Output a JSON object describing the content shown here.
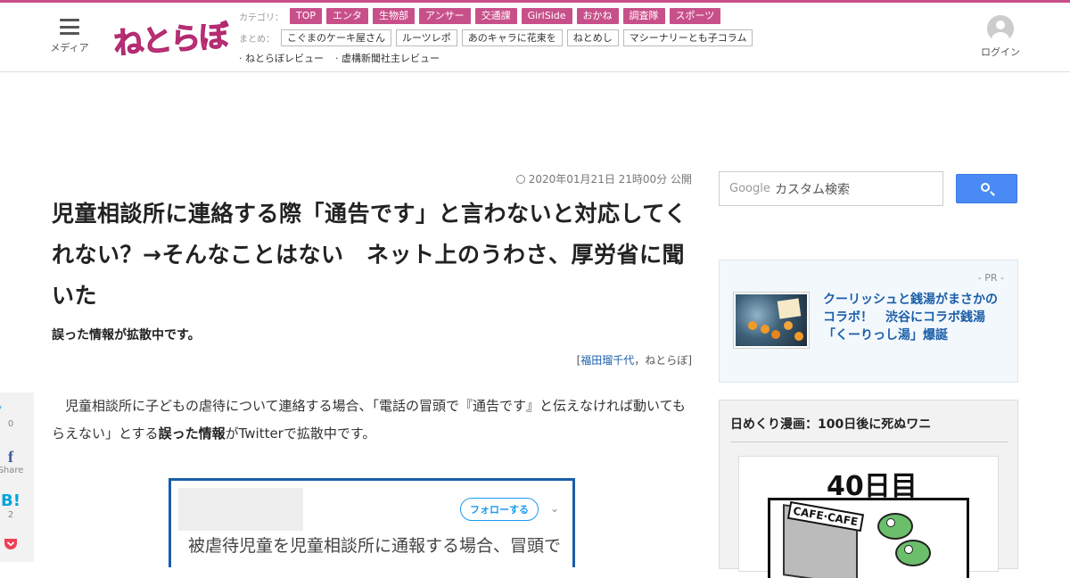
{
  "header": {
    "menu_label": "メディア",
    "logo_text": "ねとらぼ",
    "category_label": "カテゴリ：",
    "categories": [
      "TOP",
      "エンタ",
      "生物部",
      "アンサー",
      "交通課",
      "GirlSide",
      "おかね",
      "調査隊",
      "スポーツ"
    ],
    "summary_label": "まとめ：",
    "summaries": [
      "こぐまのケーキ屋さん",
      "ルーツレポ",
      "あのキャラに花束を",
      "ねとめし",
      "マシーナリーとも子コラム"
    ],
    "reviews": [
      "· ねとらぼレビュー",
      "· 虚構新聞社主レビュー"
    ],
    "login_label": "ログイン",
    "accent_color": "#c8508a"
  },
  "share": {
    "twitter": {
      "icon": "twitter-icon",
      "count": "0"
    },
    "facebook": {
      "icon": "facebook-icon",
      "count": "Share"
    },
    "hatena": {
      "icon": "hatena-bookmark-icon",
      "count": "2"
    },
    "pocket": {
      "icon": "pocket-icon"
    }
  },
  "article": {
    "date": "2020年01月21日 21時00分 公開",
    "title": "児童相談所に連絡する際「通告です」と言わないと対応してくれない？→そんなことはない　ネット上のうわさ、厚労省に聞いた",
    "lead": "誤った情報が拡散中です。",
    "author": "福田瑠千代",
    "site": "ねとらぼ",
    "body_1": "児童相談所に子どもの虐待について連絡する場合、「電話の冒頭で『通告です』と伝えなければ動いてもらえない」とする",
    "body_bold": "誤った情報",
    "body_2": "がTwitterで拡散中です。"
  },
  "embed": {
    "follow_label": "フォローする",
    "tweet_text": "被虐待児童を児童相談所に通報する場合、冒頭で"
  },
  "sidebar": {
    "search_brand": "Google",
    "search_placeholder": "カスタム検索",
    "pr_tag": "- PR -",
    "pr_link": "クーリッシュと銭湯がまさかのコラボ！　渋谷にコラボ銭湯「くーりっし湯」爆誕",
    "manga_title": "日めくり漫画：100日後に死ぬワニ",
    "manga_day": "40日目",
    "manga_sign": "CAFE·CAFE"
  }
}
